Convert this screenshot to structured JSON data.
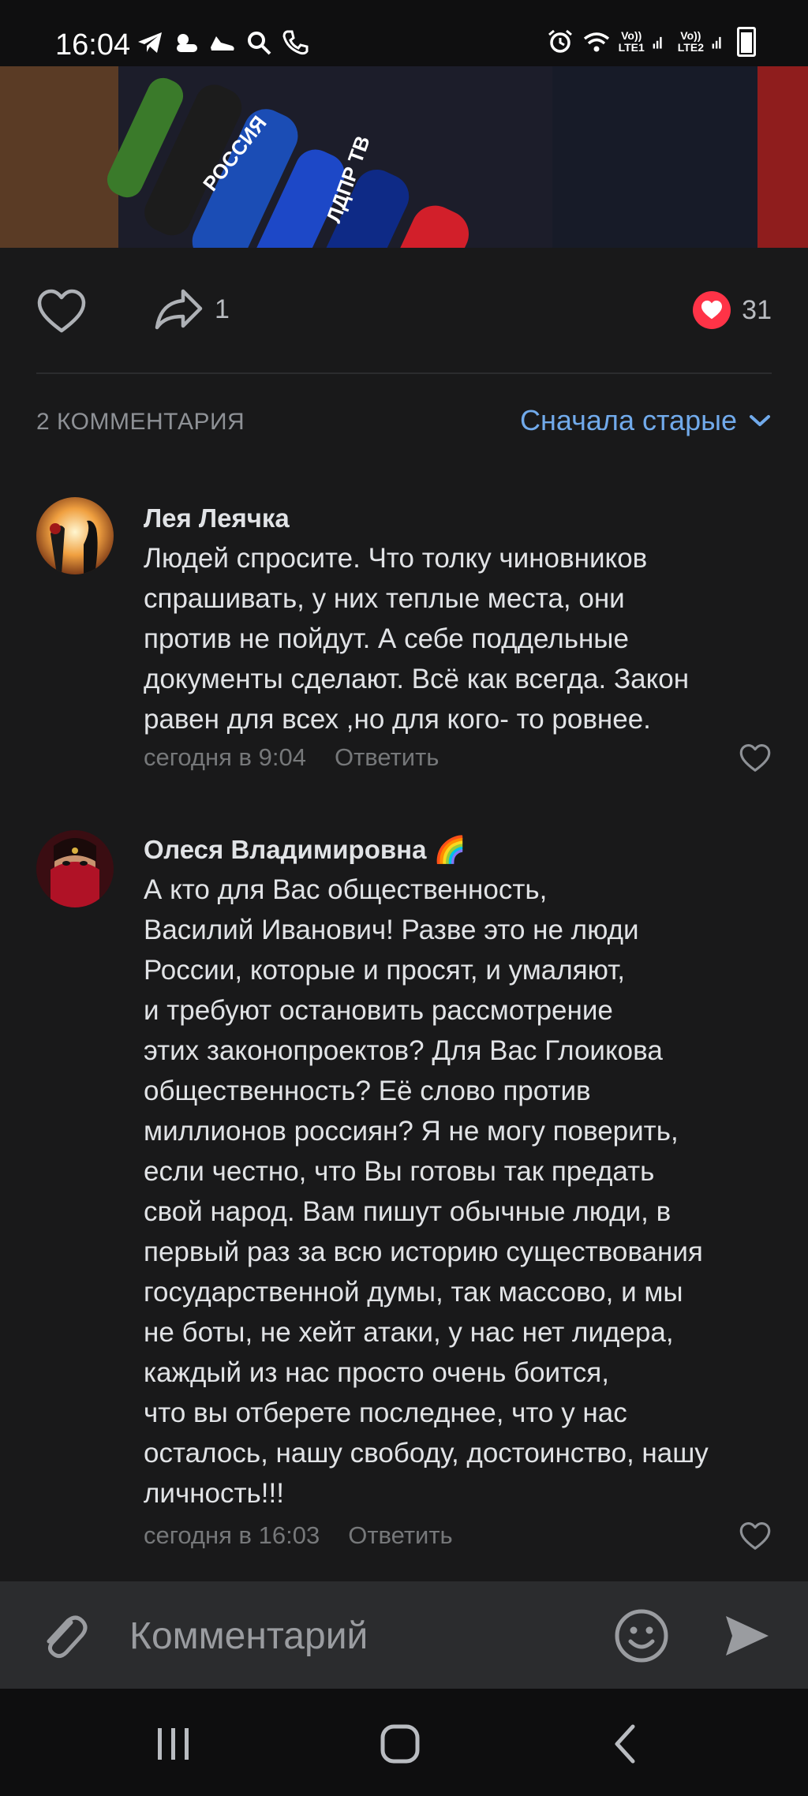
{
  "status_bar": {
    "time": "16:04",
    "left_icons": [
      "telegram-icon",
      "weather-icon",
      "shoe-icon",
      "search-icon",
      "call-icon"
    ],
    "right_icons": [
      "alarm-icon",
      "wifi-icon",
      "signal-icon",
      "battery-icon"
    ],
    "sim1_label": "Vo))\nLTE1",
    "sim2_label": "Vo))\nLTE2"
  },
  "post": {
    "share_count": "1",
    "reactions_count": "31"
  },
  "comments_section": {
    "count_label": "2 КОММЕНТАРИЯ",
    "sort_label": "Сначала старые"
  },
  "comments": [
    {
      "author": "Лея Леячка",
      "text": "Людей спросите. Что толку чиновников\nспрашивать, у них теплые места, они\nпротив не пойдут. А себе поддельные\nдокументы сделают. Всё как всегда. Закон\nравен для всех ,но для кого- то ровнее.",
      "time": "сегодня в 9:04",
      "reply_label": "Ответить"
    },
    {
      "author": "Олеся Владимировна 🌈",
      "text": "А кто для Вас общественность,\nВасилий Иванович! Разве это не люди\nРоссии, которые и просят, и умаляют,\nи требуют остановить рассмотрение\nэтих законопроектов? Для Вас Глоикова\nобщественность? Её слово против\nмиллионов россиян? Я не могу поверить,\nесли честно, что Вы готовы так предать\nсвой народ. Вам пишут обычные люди, в\nпервый раз за всю историю существования\nгосударственной думы, так массово,  и мы\nне боты, не хейт атаки, у нас нет лидера,\nкаждый из нас просто очень боится,\nчто вы отберете последнее, что у нас\nосталось, нашу свободу, достоинство, нашу\nличность!!!",
      "time": "сегодня в 16:03",
      "reply_label": "Ответить"
    }
  ],
  "composer": {
    "placeholder": "Комментарий"
  },
  "colors": {
    "background": "#19191a",
    "accent": "#71aaeb",
    "like_red": "#ff3347",
    "secondary_text": "#76787a"
  }
}
